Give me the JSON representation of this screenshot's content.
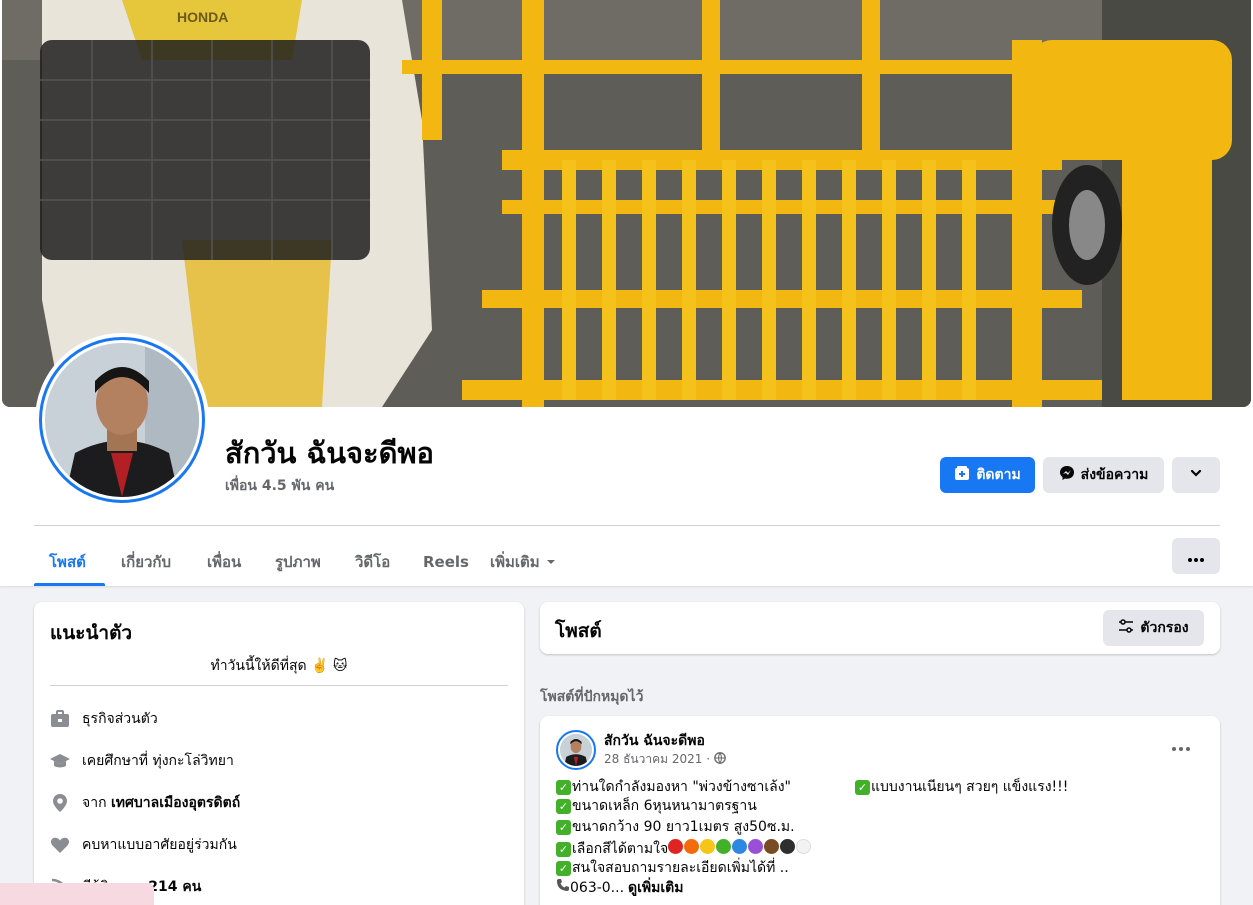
{
  "profile": {
    "name": "สักวัน ฉันจะดีพอ",
    "friends": "เพื่อน 4.5 พัน คน"
  },
  "cover": {
    "brand_text": "HONDA"
  },
  "actions": {
    "follow_label": "ติดตาม",
    "message_label": "ส่งข้อความ"
  },
  "tabs": [
    {
      "label": "โพสต์",
      "active": true
    },
    {
      "label": "เกี่ยวกับ"
    },
    {
      "label": "เพื่อน"
    },
    {
      "label": "รูปภาพ"
    },
    {
      "label": "วิดีโอ"
    },
    {
      "label": "Reels"
    },
    {
      "label": "เพิ่มเติม"
    }
  ],
  "intro": {
    "title": "แนะนำตัว",
    "bio": "ทำวันนี้ให้ดีที่สุด ✌️ 🐱",
    "items": [
      {
        "icon": "briefcase-icon",
        "text": "ธุรกิจส่วนตัว"
      },
      {
        "icon": "graduation-cap-icon",
        "text": "เคยศึกษาที่ ทุ่งกะโล่วิทยา"
      },
      {
        "icon": "location-pin-icon",
        "prefix": "จาก ",
        "text": "เทศบาลเมืองอุตรดิตถ์"
      },
      {
        "icon": "heart-icon",
        "text": "คบหาแบบอาศัยอยู่ร่วมกัน"
      },
      {
        "icon": "rss-icon",
        "prefix": "มีผู้ติดตาม ",
        "text": "214 คน"
      }
    ]
  },
  "posts": {
    "title": "โพสต์",
    "filter_label": "ตัวกรอง",
    "pinned_label": "โพสต์ที่ปักหมุดไว้"
  },
  "pinned_post": {
    "author": "สักวัน ฉันจะดีพอ",
    "date": "28 ธันวาคม 2021 ·",
    "lines": [
      "ท่านใดกำลังมองหา \"พ่วงข้างซาเล้ง\"",
      "แบบงานเนียนๆ สวยๆ แข็งแรง!!!",
      "ขนาดเหล็ก 6หุนหนามาตรฐาน",
      "ขนาดกว้าง 90 ยาว1เมตร สูง50ซ.ม.",
      "เลือกสีได้ตามใจ",
      "สนใจสอบถามรายละเอียดเพิ่มได้ที่ ..",
      "063-0..."
    ],
    "see_more": "ดูเพิ่มเติม",
    "color_dots": [
      "#e02424",
      "#f26b0c",
      "#f5c518",
      "#43b02a",
      "#2d88e3",
      "#9b4fd6",
      "#7a4a23",
      "#2e2e2e",
      "#f2f2f2"
    ]
  }
}
